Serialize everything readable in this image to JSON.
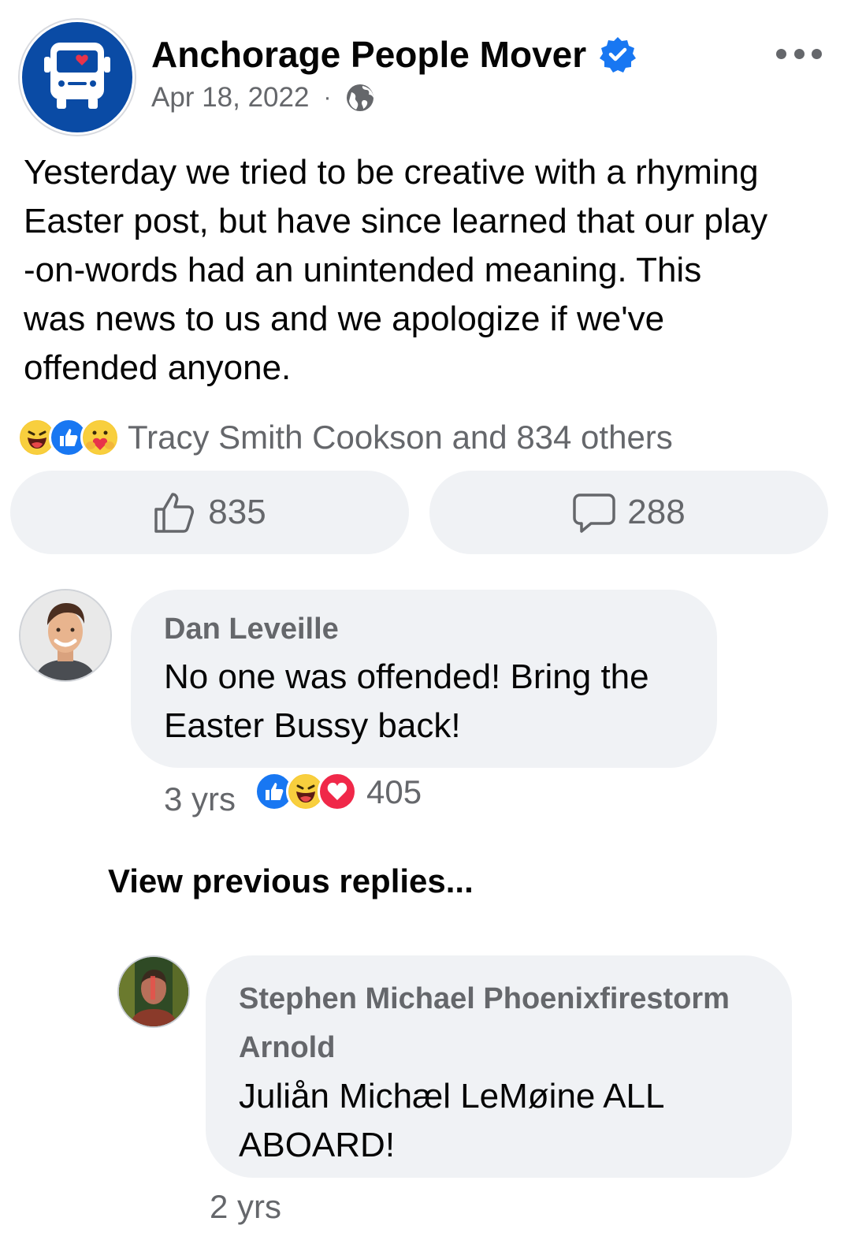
{
  "post": {
    "page_name": "Anchorage People Mover",
    "date": "Apr 18, 2022",
    "separator": "·",
    "text": "Yesterday we tried to be creative with a rhyming\nEaster post, but have since learned that our play\n-on-words had an unintended meaning. This\nwas news to us and we apologize if we've\noffended anyone.",
    "reactions_summary": "Tracy Smith Cookson and 834 others",
    "reaction_icons": [
      "haha-icon",
      "like-icon",
      "care-icon"
    ],
    "like_count": "835",
    "comment_count": "288"
  },
  "comments": [
    {
      "author": "Dan Leveille",
      "text_line1": "No one was offended! Bring the",
      "text_line2": "Easter Bussy back!",
      "time": "3 yrs",
      "reaction_icons": [
        "like-icon",
        "haha-icon",
        "love-icon"
      ],
      "reaction_count": "405"
    }
  ],
  "view_previous": "View previous replies...",
  "replies": [
    {
      "author_line1": "Stephen Michael Phoenixfirestorm",
      "author_line2": "Arnold",
      "text_line1": "Juliån Michæl LeMøine ALL",
      "text_line2": "ABOARD!",
      "time": "2 yrs"
    }
  ],
  "colors": {
    "brand_blue": "#0a4ba5",
    "verified_blue": "#1877f2",
    "bubble_bg": "#f0f2f5",
    "muted_text": "#65676b"
  }
}
